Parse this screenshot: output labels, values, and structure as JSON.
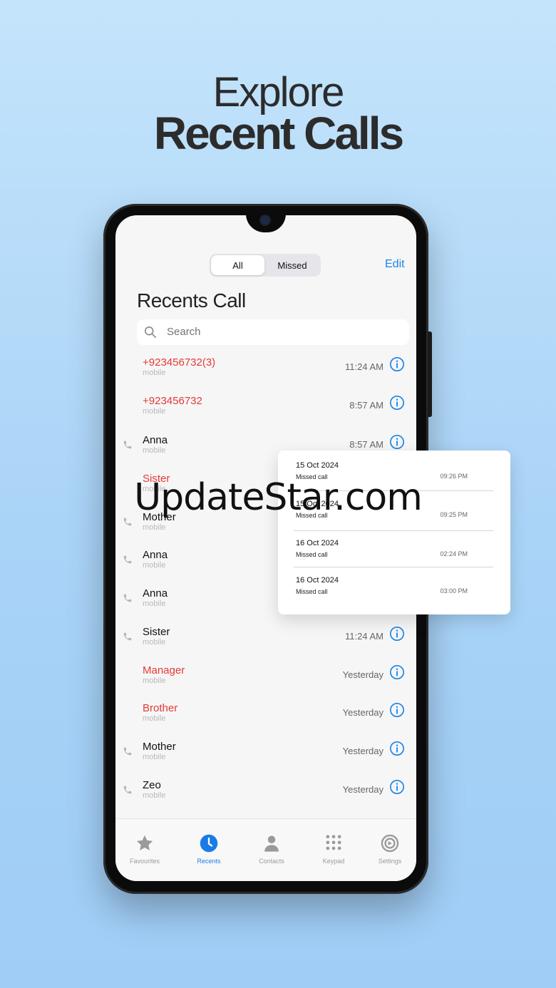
{
  "headline": {
    "line1": "Explore",
    "line2": "Recent Calls"
  },
  "segmented": {
    "all_label": "All",
    "missed_label": "Missed"
  },
  "header": {
    "edit_label": "Edit",
    "title": "Recents Call"
  },
  "search": {
    "placeholder": "Search"
  },
  "calls": [
    {
      "name": "+923456732(3)",
      "type": "mobile",
      "time": "11:24 AM",
      "missed": true,
      "outgoing": false
    },
    {
      "name": "+923456732",
      "type": "mobile",
      "time": "8:57 AM",
      "missed": true,
      "outgoing": false
    },
    {
      "name": "Anna",
      "type": "mobile",
      "time": "8:57 AM",
      "missed": false,
      "outgoing": true
    },
    {
      "name": "Sister",
      "type": "mobile",
      "time": "",
      "missed": true,
      "outgoing": false
    },
    {
      "name": "Mother",
      "type": "mobile",
      "time": "",
      "missed": false,
      "outgoing": true
    },
    {
      "name": "Anna",
      "type": "mobile",
      "time": "",
      "missed": false,
      "outgoing": true
    },
    {
      "name": "Anna",
      "type": "mobile",
      "time": "",
      "missed": false,
      "outgoing": true
    },
    {
      "name": "Sister",
      "type": "mobile",
      "time": "11:24 AM",
      "missed": false,
      "outgoing": true
    },
    {
      "name": "Manager",
      "type": "mobile",
      "time": "Yesterday",
      "missed": true,
      "outgoing": false
    },
    {
      "name": "Brother",
      "type": "mobile",
      "time": "Yesterday",
      "missed": true,
      "outgoing": false
    },
    {
      "name": "Mother",
      "type": "mobile",
      "time": "Yesterday",
      "missed": false,
      "outgoing": true
    },
    {
      "name": "Zeo",
      "type": "mobile",
      "time": "Yesterday",
      "missed": false,
      "outgoing": true
    }
  ],
  "popup": [
    {
      "date": "15 Oct 2024",
      "type": "Missed call",
      "time": "09:26 PM"
    },
    {
      "date": "15 Oct 2024",
      "type": "Missed call",
      "time": "09:25 PM"
    },
    {
      "date": "16 Oct 2024",
      "type": "Missed call",
      "time": "02:24 PM"
    },
    {
      "date": "16 Oct 2024",
      "type": "Missed call",
      "time": "03:00 PM"
    }
  ],
  "tabs": [
    {
      "label": "Favourites",
      "icon": "star-icon",
      "active": false
    },
    {
      "label": "Recents",
      "icon": "clock-icon",
      "active": true
    },
    {
      "label": "Contacts",
      "icon": "person-icon",
      "active": false
    },
    {
      "label": "Keypad",
      "icon": "keypad-icon",
      "active": false
    },
    {
      "label": "Settings",
      "icon": "gear-icon",
      "active": false
    }
  ],
  "watermark": "UpdateStar.com",
  "colors": {
    "accent": "#1a84e8",
    "missed": "#e53935",
    "background": "#b3d9f8"
  }
}
